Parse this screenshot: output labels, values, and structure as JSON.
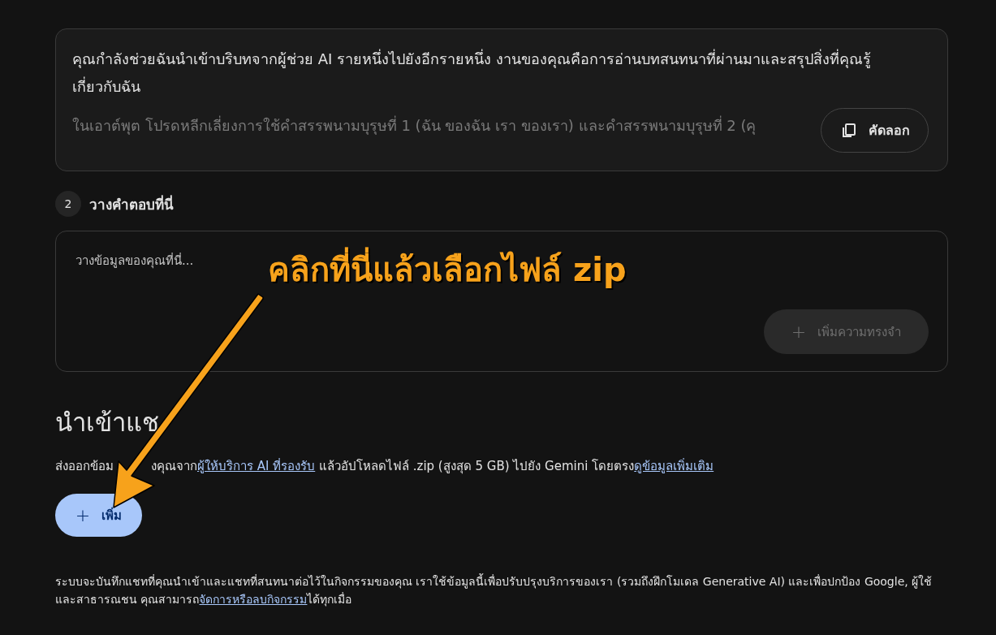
{
  "prompt_card": {
    "paragraphs": [
      "คุณกำลังช่วยฉันนำเข้าบริบทจากผู้ช่วย AI รายหนึ่งไปยังอีกรายหนึ่ง งานของคุณคือการอ่านบทสนทนาที่ผ่านมาและสรุปสิ่งที่คุณรู้เกี่ยวกับฉัน",
      "ในเอาต์พุต โปรดหลีกเลี่ยงการใช้คำสรรพนามบุรุษที่ 1 (ฉัน ของฉัน เรา ของเรา) และคำสรรพนามบุรุษที่ 2 (คุ"
    ],
    "copy_button": "คัดลอก"
  },
  "step": {
    "number": "2",
    "title": "วางคำตอบที่นี่"
  },
  "paste_card": {
    "placeholder": "วางข้อมูลของคุณที่นี่...",
    "button": {
      "icon": "+",
      "label": "เพิ่มความทรงจำ",
      "disabled": true
    }
  },
  "import_section": {
    "heading": "นำเข้าแช",
    "description_start": "ส่งออกข้อม",
    "description": [
      "งคุณจาก",
      {
        "link": "ผู้ให้บริการ AI ที่รองรับ"
      },
      " แล้วอัปโหลดไฟล์ .zip (สูงสุด 5 GB) ไปยัง Gemini โดยตรง",
      {
        "link": "ดูข้อมูลเพิ่มเติม"
      }
    ],
    "add_button": {
      "icon": "+",
      "label": "เพิ่ม"
    }
  },
  "footer": [
    "ระบบจะบันทึกแชทที่คุณนำเข้าและแชทที่สนทนาต่อไว้ในกิจกรรมของคุณ เราใช้ข้อมูลนี้เพื่อปรับปรุงบริการของเรา (รวมถึงฝึกโมเดล Generative AI) และเพื่อปกป้อง Google, ผู้ใช้ และสาธารณชน คุณสามารถ",
    {
      "link": "จัดการหรือลบกิจกรรม"
    },
    "ได้ทุกเมื่อ"
  ],
  "annotation": {
    "text": "คลิกที่นี่แล้วเลือกไฟล์ zip"
  }
}
